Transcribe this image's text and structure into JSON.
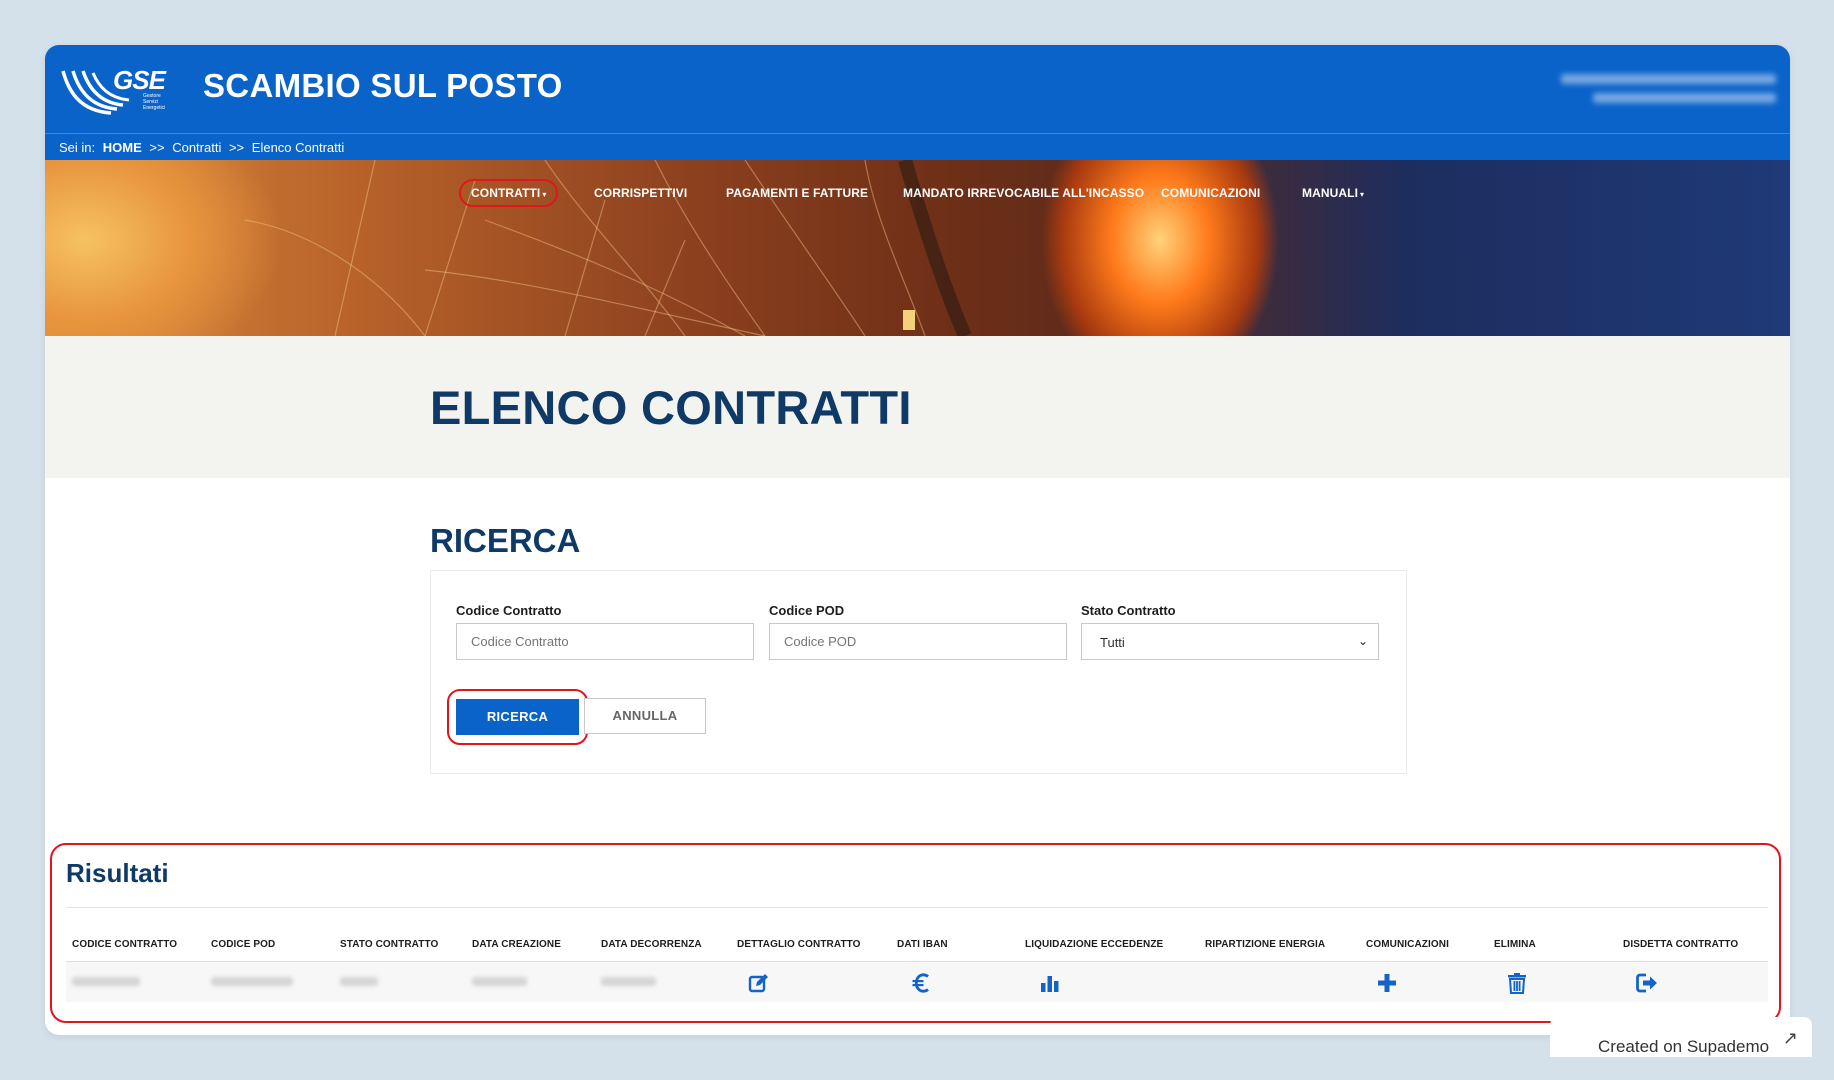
{
  "header": {
    "logo_text": "GSE",
    "logo_subtitle": "Gestore Servizi Energetici",
    "app_title": "SCAMBIO SUL POSTO"
  },
  "breadcrumb": {
    "prefix": "Sei in:",
    "home": "HOME",
    "sep1": ">>",
    "level1": "Contratti",
    "sep2": ">>",
    "level2": "Elenco Contratti"
  },
  "nav": {
    "items": [
      {
        "label": "CONTRATTI",
        "has_caret": true
      },
      {
        "label": "CORRISPETTIVI"
      },
      {
        "label": "PAGAMENTI E FATTURE"
      },
      {
        "label": "MANDATO IRREVOCABILE ALL'INCASSO"
      },
      {
        "label": "COMUNICAZIONI"
      },
      {
        "label": "MANUALI",
        "has_caret": true
      }
    ],
    "caret": "▾"
  },
  "page": {
    "title": "ELENCO CONTRATTI"
  },
  "search": {
    "title": "RICERCA",
    "fields": {
      "codice_contratto": {
        "label": "Codice Contratto",
        "placeholder": "Codice Contratto",
        "value": ""
      },
      "codice_pod": {
        "label": "Codice POD",
        "placeholder": "Codice POD",
        "value": ""
      },
      "stato_contratto": {
        "label": "Stato Contratto",
        "selected": "Tutti"
      }
    },
    "search_button": "RICERCA",
    "cancel_button": "ANNULLA"
  },
  "results": {
    "title": "Risultati",
    "columns": [
      "CODICE CONTRATTO",
      "CODICE POD",
      "STATO CONTRATTO",
      "DATA CREAZIONE",
      "DATA DECORRENZA",
      "DETTAGLIO CONTRATTO",
      "DATI IBAN",
      "LIQUIDAZIONE ECCEDENZE",
      "RIPARTIZIONE ENERGIA",
      "COMUNICAZIONI",
      "ELIMINA",
      "DISDETTA CONTRATTO"
    ],
    "row_icons": {
      "dettaglio": "edit-icon",
      "iban": "euro-icon",
      "liquidazione": "bar-chart-icon",
      "comunicazioni": "plus-icon",
      "elimina": "trash-icon",
      "disdetta": "sign-out-icon"
    }
  },
  "footer_badge": {
    "label": "Created on Supademo",
    "arrow": "↗"
  },
  "colors": {
    "brand_blue": "#0a63c9",
    "title_navy": "#0f3966",
    "highlight_red": "#e0161d",
    "background": "#d4e1ea"
  }
}
